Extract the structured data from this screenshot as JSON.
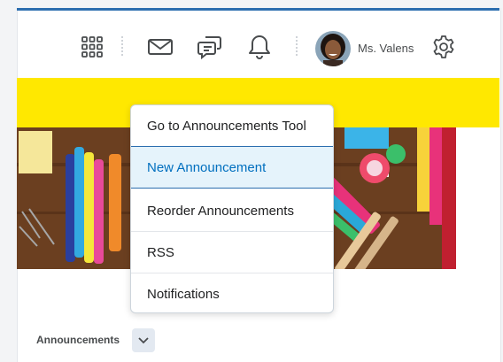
{
  "navbar": {
    "icons": [
      "waffle-grid-icon",
      "envelope-icon",
      "chat-icon",
      "bell-icon",
      "gear-icon"
    ],
    "user_name": "Ms. Valens"
  },
  "dropdown": {
    "items": [
      {
        "label": "Go to Announcements Tool"
      },
      {
        "label": "New Announcement"
      },
      {
        "label": "Reorder Announcements"
      },
      {
        "label": "RSS"
      },
      {
        "label": "Notifications"
      }
    ],
    "highlighted": "New Announcement"
  },
  "widget": {
    "title": "Announcements",
    "chevron_icon": "chevron-down-icon"
  },
  "colors": {
    "top_border": "#2c6eaf",
    "banner_band": "#ffe800",
    "highlight_bg": "#e5f3fb",
    "highlight_text": "#006fbf"
  }
}
